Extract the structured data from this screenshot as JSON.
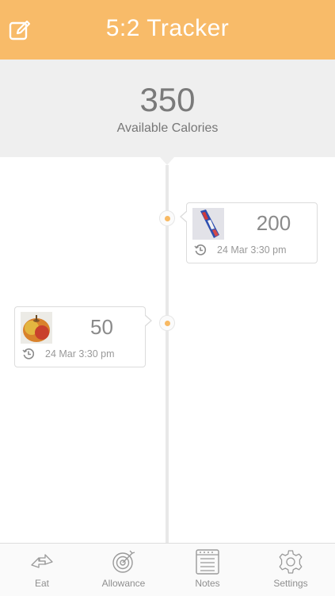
{
  "header": {
    "title": "5:2 Tracker",
    "edit_icon": "edit-icon"
  },
  "summary": {
    "value": "350",
    "label": "Available Calories"
  },
  "entries": [
    {
      "calories": "200",
      "time": "24 Mar 3:30 pm",
      "thumbnail": "bottle-image",
      "side": "right"
    },
    {
      "calories": "50",
      "time": "24 Mar 3:30 pm",
      "thumbnail": "apple-image",
      "side": "left"
    }
  ],
  "tabs": [
    {
      "label": "Eat",
      "icon": "eat-arrows-icon"
    },
    {
      "label": "Allowance",
      "icon": "target-icon"
    },
    {
      "label": "Notes",
      "icon": "notes-icon"
    },
    {
      "label": "Settings",
      "icon": "gear-icon"
    }
  ],
  "colors": {
    "accent": "#f8bb69",
    "dot": "#f8b963",
    "summary_bg": "#efefef"
  }
}
